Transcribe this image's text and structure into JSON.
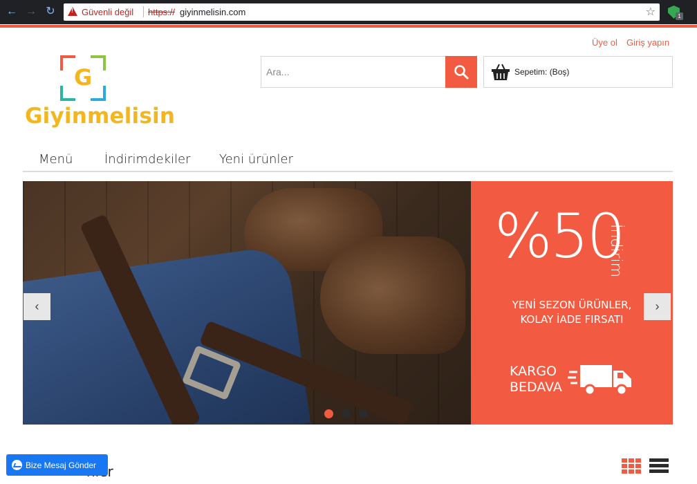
{
  "browser": {
    "security_label": "Güvenli değil",
    "url_scheme": "https://",
    "url_host": "giyinmelisin.com",
    "extension_badge": "1",
    "icons": [
      "back-icon",
      "forward-icon",
      "reload-icon",
      "warning-icon",
      "star-icon",
      "extension-shield-icon"
    ]
  },
  "header": {
    "signup_label": "Üye ol",
    "login_label": "Giriş yapın",
    "logo_letter": "G",
    "logo_text": "Giyinmelisin"
  },
  "search": {
    "placeholder": "Ara..."
  },
  "cart": {
    "label": "Sepetim: (Boş)"
  },
  "menu": {
    "items": [
      {
        "label": "Menü"
      },
      {
        "label": "İndirimdekiler"
      },
      {
        "label": "Yeni ürünler"
      }
    ]
  },
  "slider": {
    "promo_big": "%50",
    "promo_vertical": "İndirim",
    "promo_line1": "YENİ SEZON ÜRÜNLER,",
    "promo_line2": "KOLAY İADE FIRSATI",
    "cargo_line1": "KARGO",
    "cargo_line2": "BEDAVA",
    "prev_arrow": "‹",
    "next_arrow": "›",
    "dot_count": 3,
    "active_dot": 0
  },
  "section": {
    "title_visible": "nler"
  },
  "messenger": {
    "label": "Bize Mesaj Gönder"
  },
  "colors": {
    "accent": "#f25a41",
    "logo": "#f3b61f",
    "messenger": "#1877f2"
  }
}
